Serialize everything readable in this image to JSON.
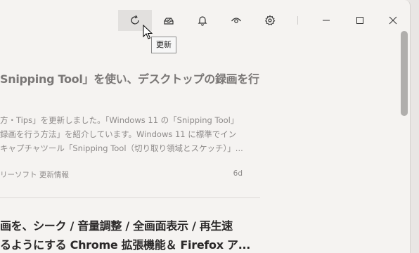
{
  "toolbar": {
    "tooltip": "更新",
    "buttons": [
      "refresh-icon",
      "inbox-icon",
      "bell-icon",
      "eye-icon",
      "gear-icon"
    ]
  },
  "window_controls": [
    "minimize",
    "maximize",
    "close"
  ],
  "articles": [
    {
      "title": "Snipping Tool」を使い、デスクトップの録画を行",
      "summary": [
        "方・Tips」を更新しました。「Windows 11 の「Snipping Tool」",
        "録画を行う方法」を紹介しています。Windows 11 に標準でイン",
        "キャプチャツール「Snipping Tool（切り取り領域とスケッチ）」..."
      ],
      "source": "リーソフト 更新情報",
      "age": "6d"
    },
    {
      "title_lines": [
        "画を、シーク / 音量調整 / 全画面表示 / 再生速",
        "るようにする Chrome 拡張機能＆ Firefox ア..."
      ]
    }
  ]
}
